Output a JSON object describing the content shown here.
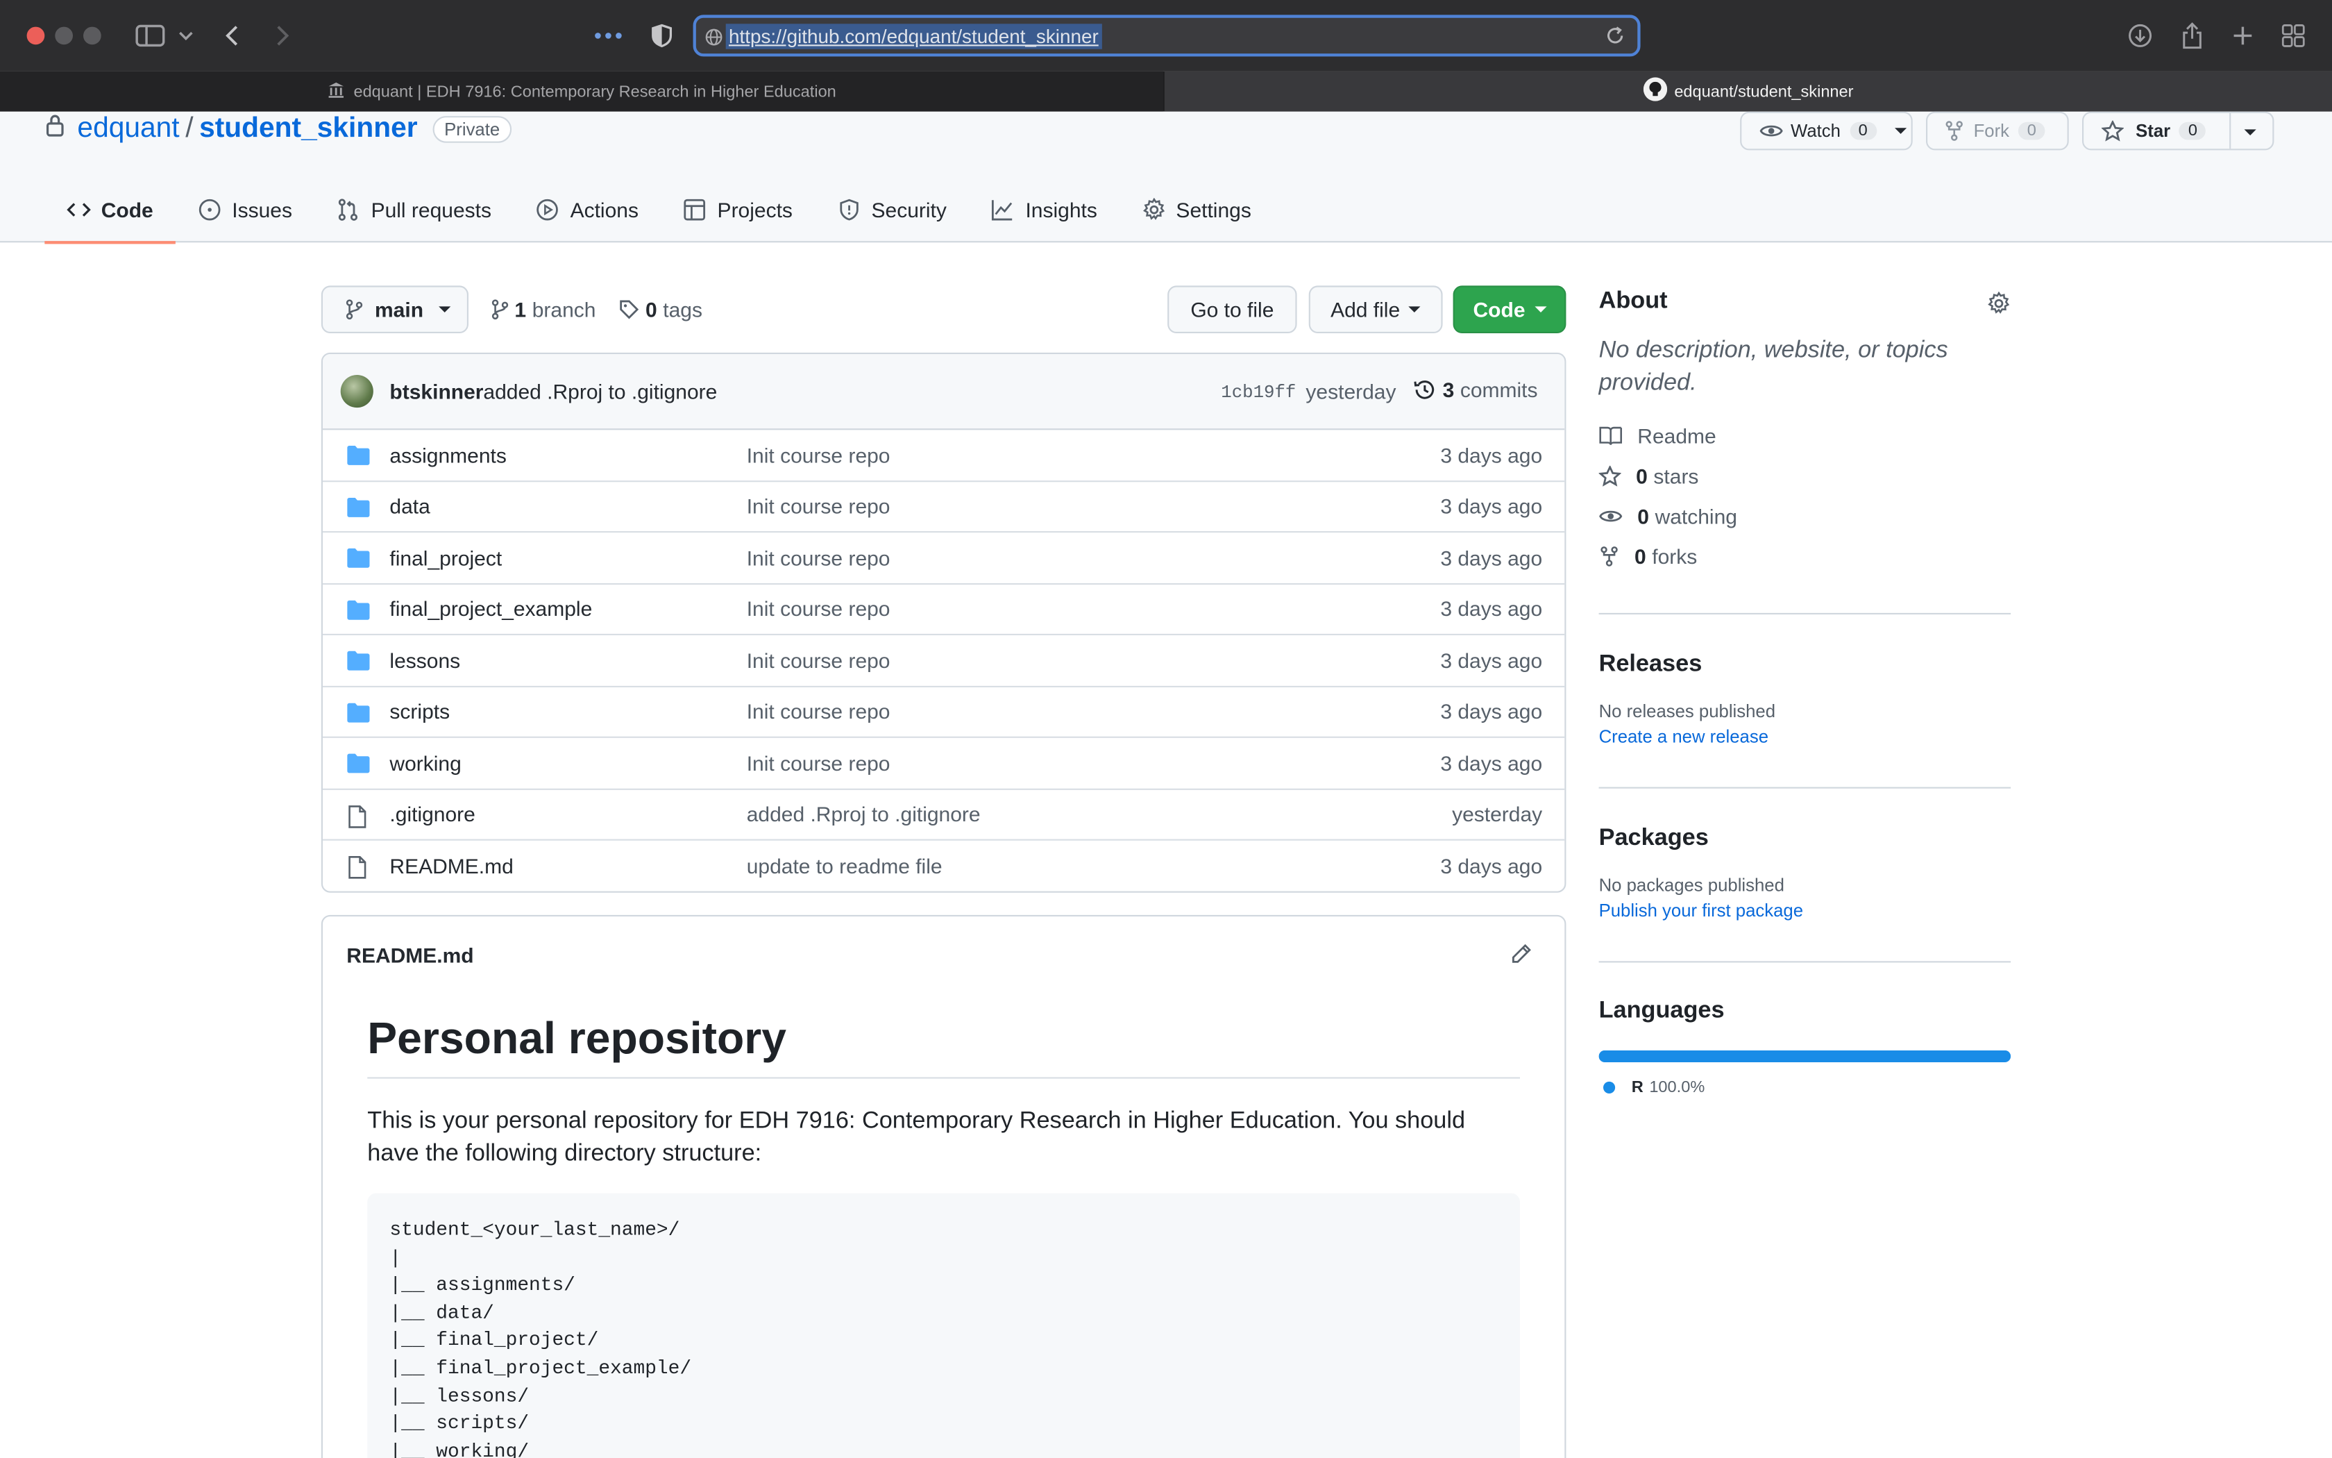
{
  "browser": {
    "url": "https://github.com/edquant/student_skinner",
    "tabs": [
      {
        "label": "edquant | EDH 7916: Contemporary Research in Higher Education",
        "active": false
      },
      {
        "label": "edquant/student_skinner",
        "active": true
      }
    ]
  },
  "repo": {
    "owner": "edquant",
    "separator": "/",
    "name": "student_skinner",
    "visibility": "Private",
    "watch": {
      "label": "Watch",
      "count": "0"
    },
    "fork": {
      "label": "Fork",
      "count": "0"
    },
    "star": {
      "label": "Star",
      "count": "0"
    }
  },
  "nav": [
    {
      "label": "Code",
      "icon": "code-icon",
      "selected": true
    },
    {
      "label": "Issues",
      "icon": "issue-icon"
    },
    {
      "label": "Pull requests",
      "icon": "pull-request-icon"
    },
    {
      "label": "Actions",
      "icon": "play-icon"
    },
    {
      "label": "Projects",
      "icon": "table-icon"
    },
    {
      "label": "Security",
      "icon": "shield-icon"
    },
    {
      "label": "Insights",
      "icon": "graph-icon"
    },
    {
      "label": "Settings",
      "icon": "gear-icon"
    }
  ],
  "branch": {
    "name": "main",
    "branch_count": "1",
    "branch_label": "branch",
    "tag_count": "0",
    "tag_label": "tags"
  },
  "actions": {
    "go_to_file": "Go to file",
    "add_file": "Add file",
    "code": "Code"
  },
  "latest_commit": {
    "author": "btskinner",
    "message": "added .Rproj to .gitignore",
    "sha": "1cb19ff",
    "time": "yesterday",
    "commit_count": "3",
    "commit_label": "commits"
  },
  "files": [
    {
      "name": "assignments",
      "type": "dir",
      "message": "Init course repo",
      "age": "3 days ago"
    },
    {
      "name": "data",
      "type": "dir",
      "message": "Init course repo",
      "age": "3 days ago"
    },
    {
      "name": "final_project",
      "type": "dir",
      "message": "Init course repo",
      "age": "3 days ago"
    },
    {
      "name": "final_project_example",
      "type": "dir",
      "message": "Init course repo",
      "age": "3 days ago"
    },
    {
      "name": "lessons",
      "type": "dir",
      "message": "Init course repo",
      "age": "3 days ago"
    },
    {
      "name": "scripts",
      "type": "dir",
      "message": "Init course repo",
      "age": "3 days ago"
    },
    {
      "name": "working",
      "type": "dir",
      "message": "Init course repo",
      "age": "3 days ago"
    },
    {
      "name": ".gitignore",
      "type": "file",
      "message": "added .Rproj to .gitignore",
      "age": "yesterday"
    },
    {
      "name": "README.md",
      "type": "file",
      "message": "update to readme file",
      "age": "3 days ago"
    }
  ],
  "readme": {
    "filename": "README.md",
    "heading": "Personal repository",
    "intro": "This is your personal repository for EDH 7916: Contemporary Research in Higher Education. You should have the following directory structure:",
    "code": "student_<your_last_name>/\n|\n|__ assignments/\n|__ data/\n|__ final_project/\n|__ final_project_example/\n|__ lessons/\n|__ scripts/\n|__ working/"
  },
  "about": {
    "title": "About",
    "description": "No description, website, or topics provided.",
    "readme_label": "Readme",
    "stars_count": "0",
    "stars_label": "stars",
    "watching_count": "0",
    "watching_label": "watching",
    "forks_count": "0",
    "forks_label": "forks"
  },
  "releases": {
    "title": "Releases",
    "empty": "No releases published",
    "link": "Create a new release"
  },
  "packages": {
    "title": "Packages",
    "empty": "No packages published",
    "link": "Publish your first package"
  },
  "languages": {
    "title": "Languages",
    "items": [
      {
        "name": "R",
        "percent": "100.0%",
        "fraction": 1.0,
        "color": "#198ce7"
      }
    ]
  },
  "colors": {
    "accent": "#0969da",
    "green": "#2da44e",
    "nav_underline": "#fd8c73"
  }
}
